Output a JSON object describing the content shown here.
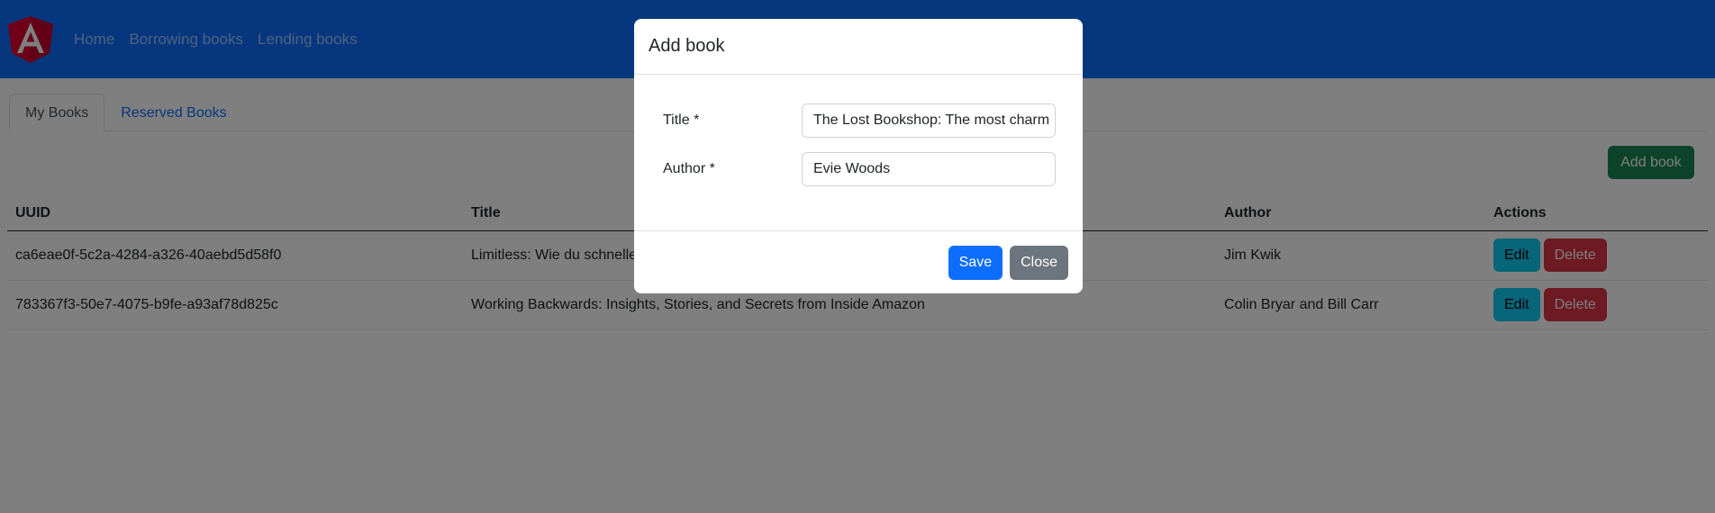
{
  "nav": {
    "logo_icon": "angular-logo-icon",
    "links": [
      "Home",
      "Borrowing books",
      "Lending books"
    ]
  },
  "tabs": [
    "My Books",
    "Reserved Books"
  ],
  "add_book_label": "Add book",
  "table": {
    "headers": [
      "UUID",
      "Title",
      "Author",
      "Actions"
    ],
    "rows": [
      {
        "uuid": "ca6eae0f-5c2a-4284-a326-40aebd5d58f0",
        "title": "Limitless: Wie du schneller lernst und dein Potenzial entfesselst",
        "author": "Jim Kwik"
      },
      {
        "uuid": "783367f3-50e7-4075-b9fe-a93af78d825c",
        "title": "Working Backwards: Insights, Stories, and Secrets from Inside Amazon",
        "author": "Colin Bryar and Bill Carr"
      }
    ],
    "edit_label": "Edit",
    "delete_label": "Delete"
  },
  "modal": {
    "title": "Add book",
    "fields": {
      "title_label": "Title *",
      "title_value": "The Lost Bookshop: The most charm",
      "author_label": "Author *",
      "author_value": "Evie Woods"
    },
    "save_label": "Save",
    "close_label": "Close"
  },
  "colors": {
    "primary": "#0d6efd",
    "success": "#198754",
    "info": "#0dcaf0",
    "danger": "#dc3545",
    "secondary": "#6c757d"
  }
}
